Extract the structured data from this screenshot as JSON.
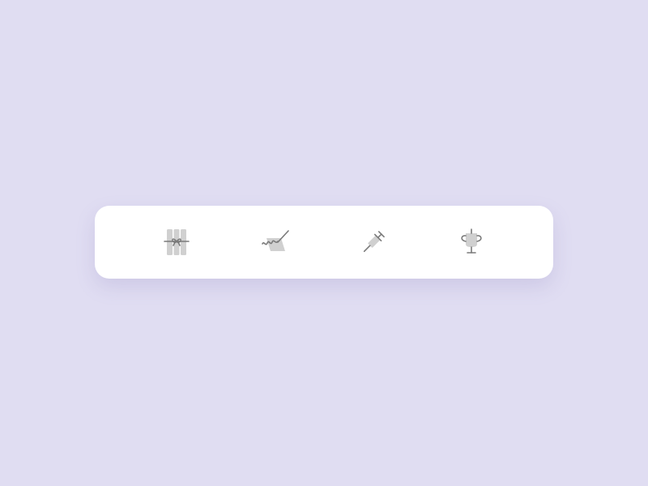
{
  "background_color": "#e0ddf2",
  "tab_bar": {
    "items": [
      {
        "icon": "dynamite-icon"
      },
      {
        "icon": "signature-pen-icon"
      },
      {
        "icon": "syringe-icon"
      },
      {
        "icon": "trophy-icon"
      }
    ]
  },
  "colors": {
    "icon_fill": "#d0d0d0",
    "icon_stroke": "#7a7a7a",
    "bar_background": "#ffffff"
  }
}
